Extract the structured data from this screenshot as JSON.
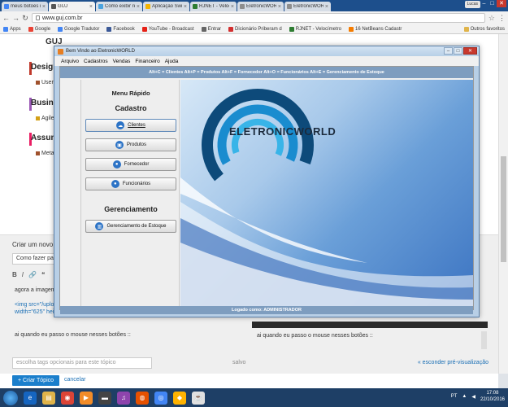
{
  "browser": {
    "tabs": [
      {
        "label": "meus botões mi",
        "color": "#4285f4",
        "active": false
      },
      {
        "label": "GUJ",
        "color": "#555555",
        "active": true
      },
      {
        "label": "Como exibir resu",
        "color": "#4aa3df",
        "active": false
      },
      {
        "label": "Aplicação Swing",
        "color": "#f4b400",
        "active": false
      },
      {
        "label": "RJNET - Velocim",
        "color": "#2e7d32",
        "active": false
      },
      {
        "label": "EletronicWORLD",
        "color": "#8e8e8e",
        "active": false
      },
      {
        "label": "EletronicWORLD",
        "color": "#8e8e8e",
        "active": false
      }
    ],
    "user": "Lucas",
    "url": "www.guj.com.br",
    "bookmarks": [
      {
        "label": "Apps",
        "color": "#4285f4"
      },
      {
        "label": "Google",
        "color": "#ea4335"
      },
      {
        "label": "Google Tradutor",
        "color": "#4285f4"
      },
      {
        "label": "Facebook",
        "color": "#3b5998"
      },
      {
        "label": "YouTube - Broadcast",
        "color": "#e62117"
      },
      {
        "label": "Entrar",
        "color": "#666666"
      },
      {
        "label": "Dicionário Priberam d",
        "color": "#d32f2f"
      },
      {
        "label": "RJNET - Velocímetro",
        "color": "#2e7d32"
      },
      {
        "label": "16 NetBeans Cadastr",
        "color": "#f57c00"
      }
    ],
    "other_bookmarks": "Outros favoritos"
  },
  "page": {
    "logo": "GUJ",
    "categories": [
      {
        "title": "Design",
        "sub": "User Ex",
        "color": "#c0392b"
      },
      {
        "title": "Busines",
        "sub": "Agile",
        "color": "#9b59b6"
      },
      {
        "title": "Assun",
        "sub": "Meta G",
        "color": "#e91e63"
      }
    ],
    "editor": {
      "heading": "Criar um novo tópi",
      "title_value": "Como fazer para",
      "toolbar": [
        "B",
        "I",
        "🔗",
        "❝"
      ],
      "lines": [
        "agora a imagem de",
        "<img src=\"/upload",
        "width=\"625\" height",
        "ai quando eu passo o mouse nesses botões ::"
      ],
      "preview_text": "ai quando eu passo o mouse nesses botões ::",
      "tags_placeholder": "escolha tags opcionais para este tópico",
      "saved": "salvo",
      "hide_preview": "« esconder pré-visualização",
      "create": "+ Criar Tópico",
      "cancel": "cancelar"
    }
  },
  "app": {
    "title": "Bem Vindo ao EletronicWORLD",
    "menu": [
      "Arquivo",
      "Cadastros",
      "Vendas",
      "Financeiro",
      "Ajuda"
    ],
    "shortcuts": "Alt+C = Clientes   Alt+P = Produtos   Alt+F = Fornecedor   Alt+O = Funcionários   Alt+E = Gerenciamento de Estoque",
    "side": {
      "quick_menu": "Menu Rápido",
      "register": "Cadastro",
      "buttons": [
        "Clientes",
        "Produtos",
        "Fornecedor",
        "Funcionários"
      ],
      "management": "Gerenciamento",
      "stock_button": "Gerenciamento de Estoque"
    },
    "brand": "ELETRONICWORLD",
    "status": "Logado como: ADMINISTRADOR"
  },
  "taskbar": {
    "lang": "PT",
    "time": "17:08",
    "date": "22/10/2016"
  }
}
